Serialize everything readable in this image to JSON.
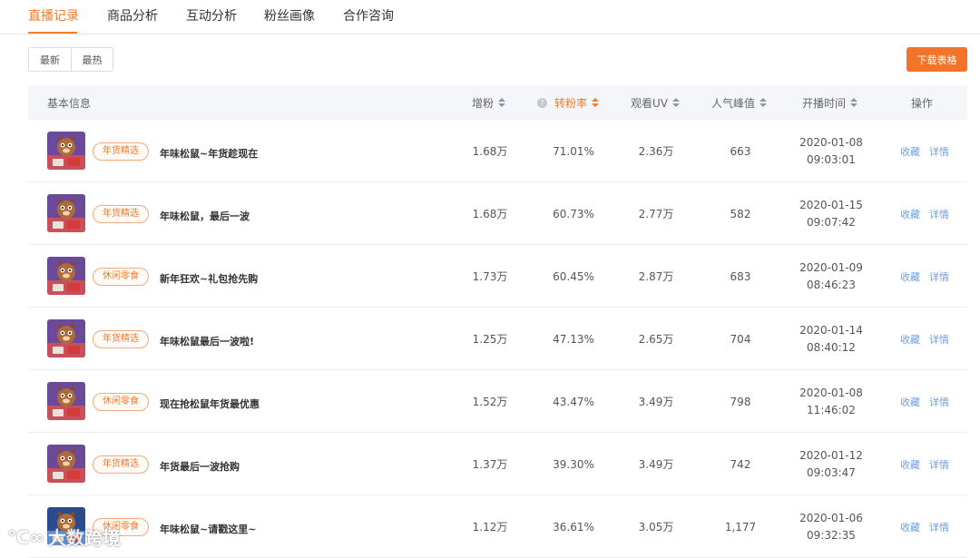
{
  "tabs": [
    "直播记录",
    "商品分析",
    "互动分析",
    "粉丝画像",
    "合作咨询"
  ],
  "active_tab": 0,
  "sort_buttons": [
    "最新",
    "最热"
  ],
  "download_label": "下载表格",
  "columns": {
    "basic_info": "基本信息",
    "fans_gain": "增粉",
    "conversion_rate": "转粉率",
    "viewers_uv": "观看UV",
    "peak_popularity": "人气峰值",
    "start_time": "开播时间",
    "actions": "操作"
  },
  "action_labels": {
    "favorite": "收藏",
    "detail": "详情"
  },
  "rows": [
    {
      "tag": "年货精选",
      "title": "年味松鼠~年货趁现在",
      "fans_gain": "1.68万",
      "conversion_rate": "71.01%",
      "viewers_uv": "2.36万",
      "peak_popularity": "663",
      "date": "2020-01-08",
      "time": "09:03:01",
      "thumb": "squirrel"
    },
    {
      "tag": "年货精选",
      "title": "年味松鼠，最后一波",
      "fans_gain": "1.68万",
      "conversion_rate": "60.73%",
      "viewers_uv": "2.77万",
      "peak_popularity": "582",
      "date": "2020-01-15",
      "time": "09:07:42",
      "thumb": "squirrel"
    },
    {
      "tag": "休闲零食",
      "title": "新年狂欢~礼包抢先购",
      "fans_gain": "1.73万",
      "conversion_rate": "60.45%",
      "viewers_uv": "2.87万",
      "peak_popularity": "683",
      "date": "2020-01-09",
      "time": "08:46:23",
      "thumb": "squirrel"
    },
    {
      "tag": "年货精选",
      "title": "年味松鼠最后一波啦!",
      "fans_gain": "1.25万",
      "conversion_rate": "47.13%",
      "viewers_uv": "2.65万",
      "peak_popularity": "704",
      "date": "2020-01-14",
      "time": "08:40:12",
      "thumb": "squirrel"
    },
    {
      "tag": "休闲零食",
      "title": "现在抢松鼠年货最优惠",
      "fans_gain": "1.52万",
      "conversion_rate": "43.47%",
      "viewers_uv": "3.49万",
      "peak_popularity": "798",
      "date": "2020-01-08",
      "time": "11:46:02",
      "thumb": "squirrel"
    },
    {
      "tag": "年货精选",
      "title": "年货最后一波抢购",
      "fans_gain": "1.37万",
      "conversion_rate": "39.30%",
      "viewers_uv": "3.49万",
      "peak_popularity": "742",
      "date": "2020-01-12",
      "time": "09:03:47",
      "thumb": "squirrel"
    },
    {
      "tag": "休闲零食",
      "title": "年味松鼠~请戳这里~",
      "fans_gain": "1.12万",
      "conversion_rate": "36.61%",
      "viewers_uv": "3.05万",
      "peak_popularity": "1,177",
      "date": "2020-01-06",
      "time": "09:32:35",
      "thumb": "squirrel-blue"
    }
  ],
  "watermark": "大数跨境",
  "colors": {
    "accent": "#f27a2a",
    "link": "#6c9fe0",
    "tag_border": "#f5a87c"
  }
}
